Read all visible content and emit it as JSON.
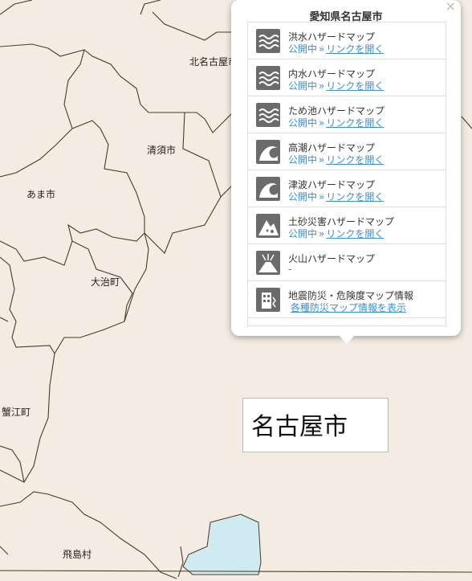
{
  "map": {
    "towns": [
      {
        "id": "kitanagoya",
        "label": "北名古屋市"
      },
      {
        "id": "kiyosu",
        "label": "清須市"
      },
      {
        "id": "ama",
        "label": "あま市"
      },
      {
        "id": "oharu",
        "label": "大治町"
      },
      {
        "id": "kanie",
        "label": "蟹江町"
      },
      {
        "id": "tobishima",
        "label": "飛島村"
      }
    ],
    "city_label": "名古屋市",
    "colors": {
      "land": "#f4ece2",
      "boundary": "#4a3a2a",
      "water": "#cfeaf0"
    }
  },
  "popup": {
    "title": "愛知県名古屋市",
    "close_symbol": "×",
    "items": [
      {
        "icon": "flood-icon",
        "title": "洪水ハザードマップ",
        "status": "公開中",
        "sep": "»",
        "link": "リンクを開く"
      },
      {
        "icon": "inland-flood-icon",
        "title": "内水ハザードマップ",
        "status": "公開中",
        "sep": "»",
        "link": "リンクを開く"
      },
      {
        "icon": "pond-icon",
        "title": "ため池ハザードマップ",
        "status": "公開中",
        "sep": "»",
        "link": "リンクを開く"
      },
      {
        "icon": "storm-surge-icon",
        "title": "高潮ハザードマップ",
        "status": "公開中",
        "sep": "»",
        "link": "リンクを開く"
      },
      {
        "icon": "tsunami-icon",
        "title": "津波ハザードマップ",
        "status": "公開中",
        "sep": "»",
        "link": "リンクを開く"
      },
      {
        "icon": "landslide-icon",
        "title": "土砂災害ハザードマップ",
        "status": "公開中",
        "sep": "»",
        "link": "リンクを開く"
      },
      {
        "icon": "volcano-icon",
        "title": "火山ハザードマップ",
        "dash": "-"
      },
      {
        "icon": "earthquake-icon",
        "title": "地震防災・危険度マップ情報",
        "link": "各種防災マップ情報を表示"
      }
    ]
  }
}
